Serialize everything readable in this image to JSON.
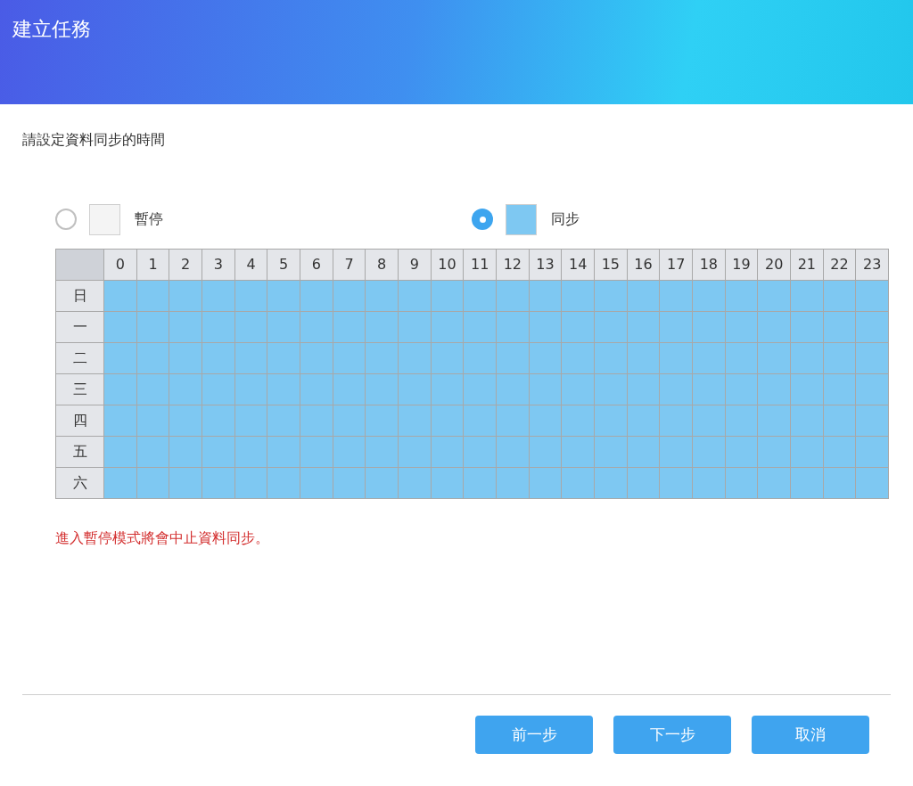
{
  "window": {
    "title": "建立任務"
  },
  "prompt": "請設定資料同步的時間",
  "modes": [
    {
      "label": "暫停",
      "selected": false,
      "color": "#f4f4f4"
    },
    {
      "label": "同步",
      "selected": true,
      "color": "#7ec8f2"
    }
  ],
  "schedule": {
    "hours": [
      "0",
      "1",
      "2",
      "3",
      "4",
      "5",
      "6",
      "7",
      "8",
      "9",
      "10",
      "11",
      "12",
      "13",
      "14",
      "15",
      "16",
      "17",
      "18",
      "19",
      "20",
      "21",
      "22",
      "23"
    ],
    "rows": [
      {
        "day": "日",
        "sync": [
          true,
          true,
          true,
          true,
          true,
          true,
          true,
          true,
          true,
          true,
          true,
          true,
          true,
          true,
          true,
          true,
          true,
          true,
          true,
          true,
          true,
          true,
          true,
          true
        ]
      },
      {
        "day": "一",
        "sync": [
          true,
          true,
          true,
          true,
          true,
          true,
          true,
          true,
          true,
          true,
          true,
          true,
          true,
          true,
          true,
          true,
          true,
          true,
          true,
          true,
          true,
          true,
          true,
          true
        ]
      },
      {
        "day": "二",
        "sync": [
          true,
          true,
          true,
          true,
          true,
          true,
          true,
          true,
          true,
          true,
          true,
          true,
          true,
          true,
          true,
          true,
          true,
          true,
          true,
          true,
          true,
          true,
          true,
          true
        ]
      },
      {
        "day": "三",
        "sync": [
          true,
          true,
          true,
          true,
          true,
          true,
          true,
          true,
          true,
          true,
          true,
          true,
          true,
          true,
          true,
          true,
          true,
          true,
          true,
          true,
          true,
          true,
          true,
          true
        ]
      },
      {
        "day": "四",
        "sync": [
          true,
          true,
          true,
          true,
          true,
          true,
          true,
          true,
          true,
          true,
          true,
          true,
          true,
          true,
          true,
          true,
          true,
          true,
          true,
          true,
          true,
          true,
          true,
          true
        ]
      },
      {
        "day": "五",
        "sync": [
          true,
          true,
          true,
          true,
          true,
          true,
          true,
          true,
          true,
          true,
          true,
          true,
          true,
          true,
          true,
          true,
          true,
          true,
          true,
          true,
          true,
          true,
          true,
          true
        ]
      },
      {
        "day": "六",
        "sync": [
          true,
          true,
          true,
          true,
          true,
          true,
          true,
          true,
          true,
          true,
          true,
          true,
          true,
          true,
          true,
          true,
          true,
          true,
          true,
          true,
          true,
          true,
          true,
          true
        ]
      }
    ]
  },
  "warning": "進入暫停模式將會中止資料同步。",
  "buttons": [
    "前一步",
    "下一步",
    "取消"
  ]
}
